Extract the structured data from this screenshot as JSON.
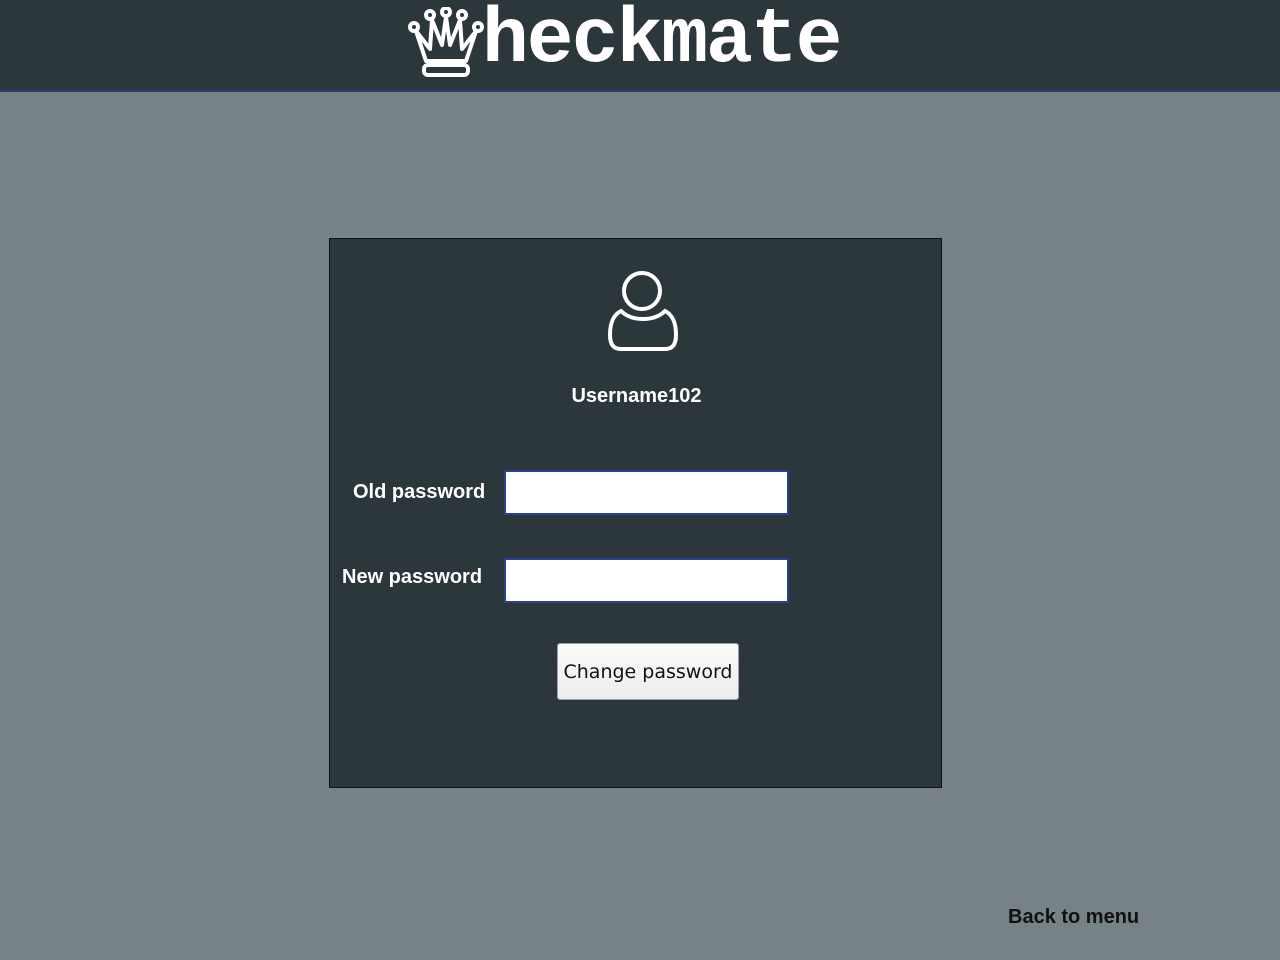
{
  "header": {
    "logo_text": "heckmate",
    "logo_icon": "queen-crown-icon"
  },
  "profile": {
    "avatar_icon": "user-icon",
    "username": "Username102"
  },
  "form": {
    "old_password_label": "Old password",
    "old_password_value": "",
    "new_password_label": "New password",
    "new_password_value": "",
    "submit_label": "Change password"
  },
  "footer": {
    "back_label": "Back to menu"
  },
  "colors": {
    "page_bg": "#778287",
    "panel_bg": "#2c373b",
    "input_border": "#2a3f9a"
  }
}
